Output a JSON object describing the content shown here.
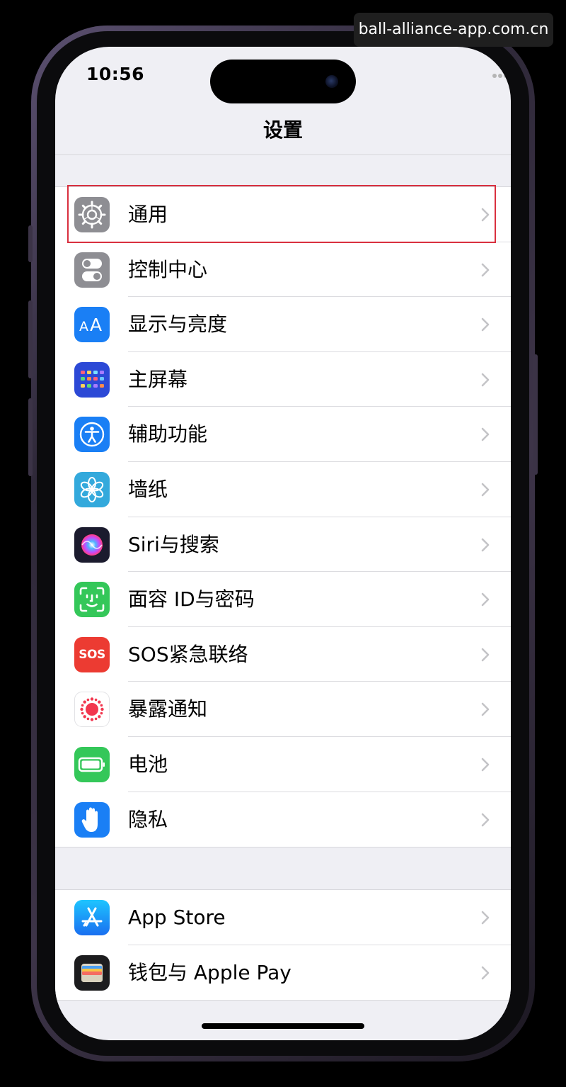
{
  "watermark": "ball-alliance-app.com.cn",
  "status_bar": {
    "time": "10:56"
  },
  "nav": {
    "title": "设置"
  },
  "groups": [
    {
      "items": [
        {
          "label": "通用",
          "icon": "gear-icon",
          "color": "#8e8e93",
          "highlighted": true
        },
        {
          "label": "控制中心",
          "icon": "toggles-icon",
          "color": "#8e8e93"
        },
        {
          "label": "显示与亮度",
          "icon": "text-size-icon",
          "color": "#1a7ff5"
        },
        {
          "label": "主屏幕",
          "icon": "app-grid-icon",
          "color": "#2c49d6"
        },
        {
          "label": "辅助功能",
          "icon": "accessibility-icon",
          "color": "#1a7ff5"
        },
        {
          "label": "墙纸",
          "icon": "flower-icon",
          "color": "#33a9dc"
        },
        {
          "label": "Siri与搜索",
          "icon": "siri-icon",
          "color": "#1b1b2e"
        },
        {
          "label": "面容 ID与密码",
          "icon": "face-id-icon",
          "color": "#34c759"
        },
        {
          "label": "SOS紧急联络",
          "icon": "sos-icon",
          "color": "#ec3b32"
        },
        {
          "label": "暴露通知",
          "icon": "exposure-icon",
          "color": "#ffffff"
        },
        {
          "label": "电池",
          "icon": "battery-icon",
          "color": "#34c759"
        },
        {
          "label": "隐私",
          "icon": "hand-icon",
          "color": "#1a7ff5"
        }
      ]
    },
    {
      "items": [
        {
          "label": "App Store",
          "icon": "app-store-icon",
          "color": "#1a8cf5"
        },
        {
          "label": "钱包与 Apple Pay",
          "icon": "wallet-icon",
          "color": "#1c1c1e"
        }
      ]
    }
  ],
  "sos_icon_text": "SOS"
}
